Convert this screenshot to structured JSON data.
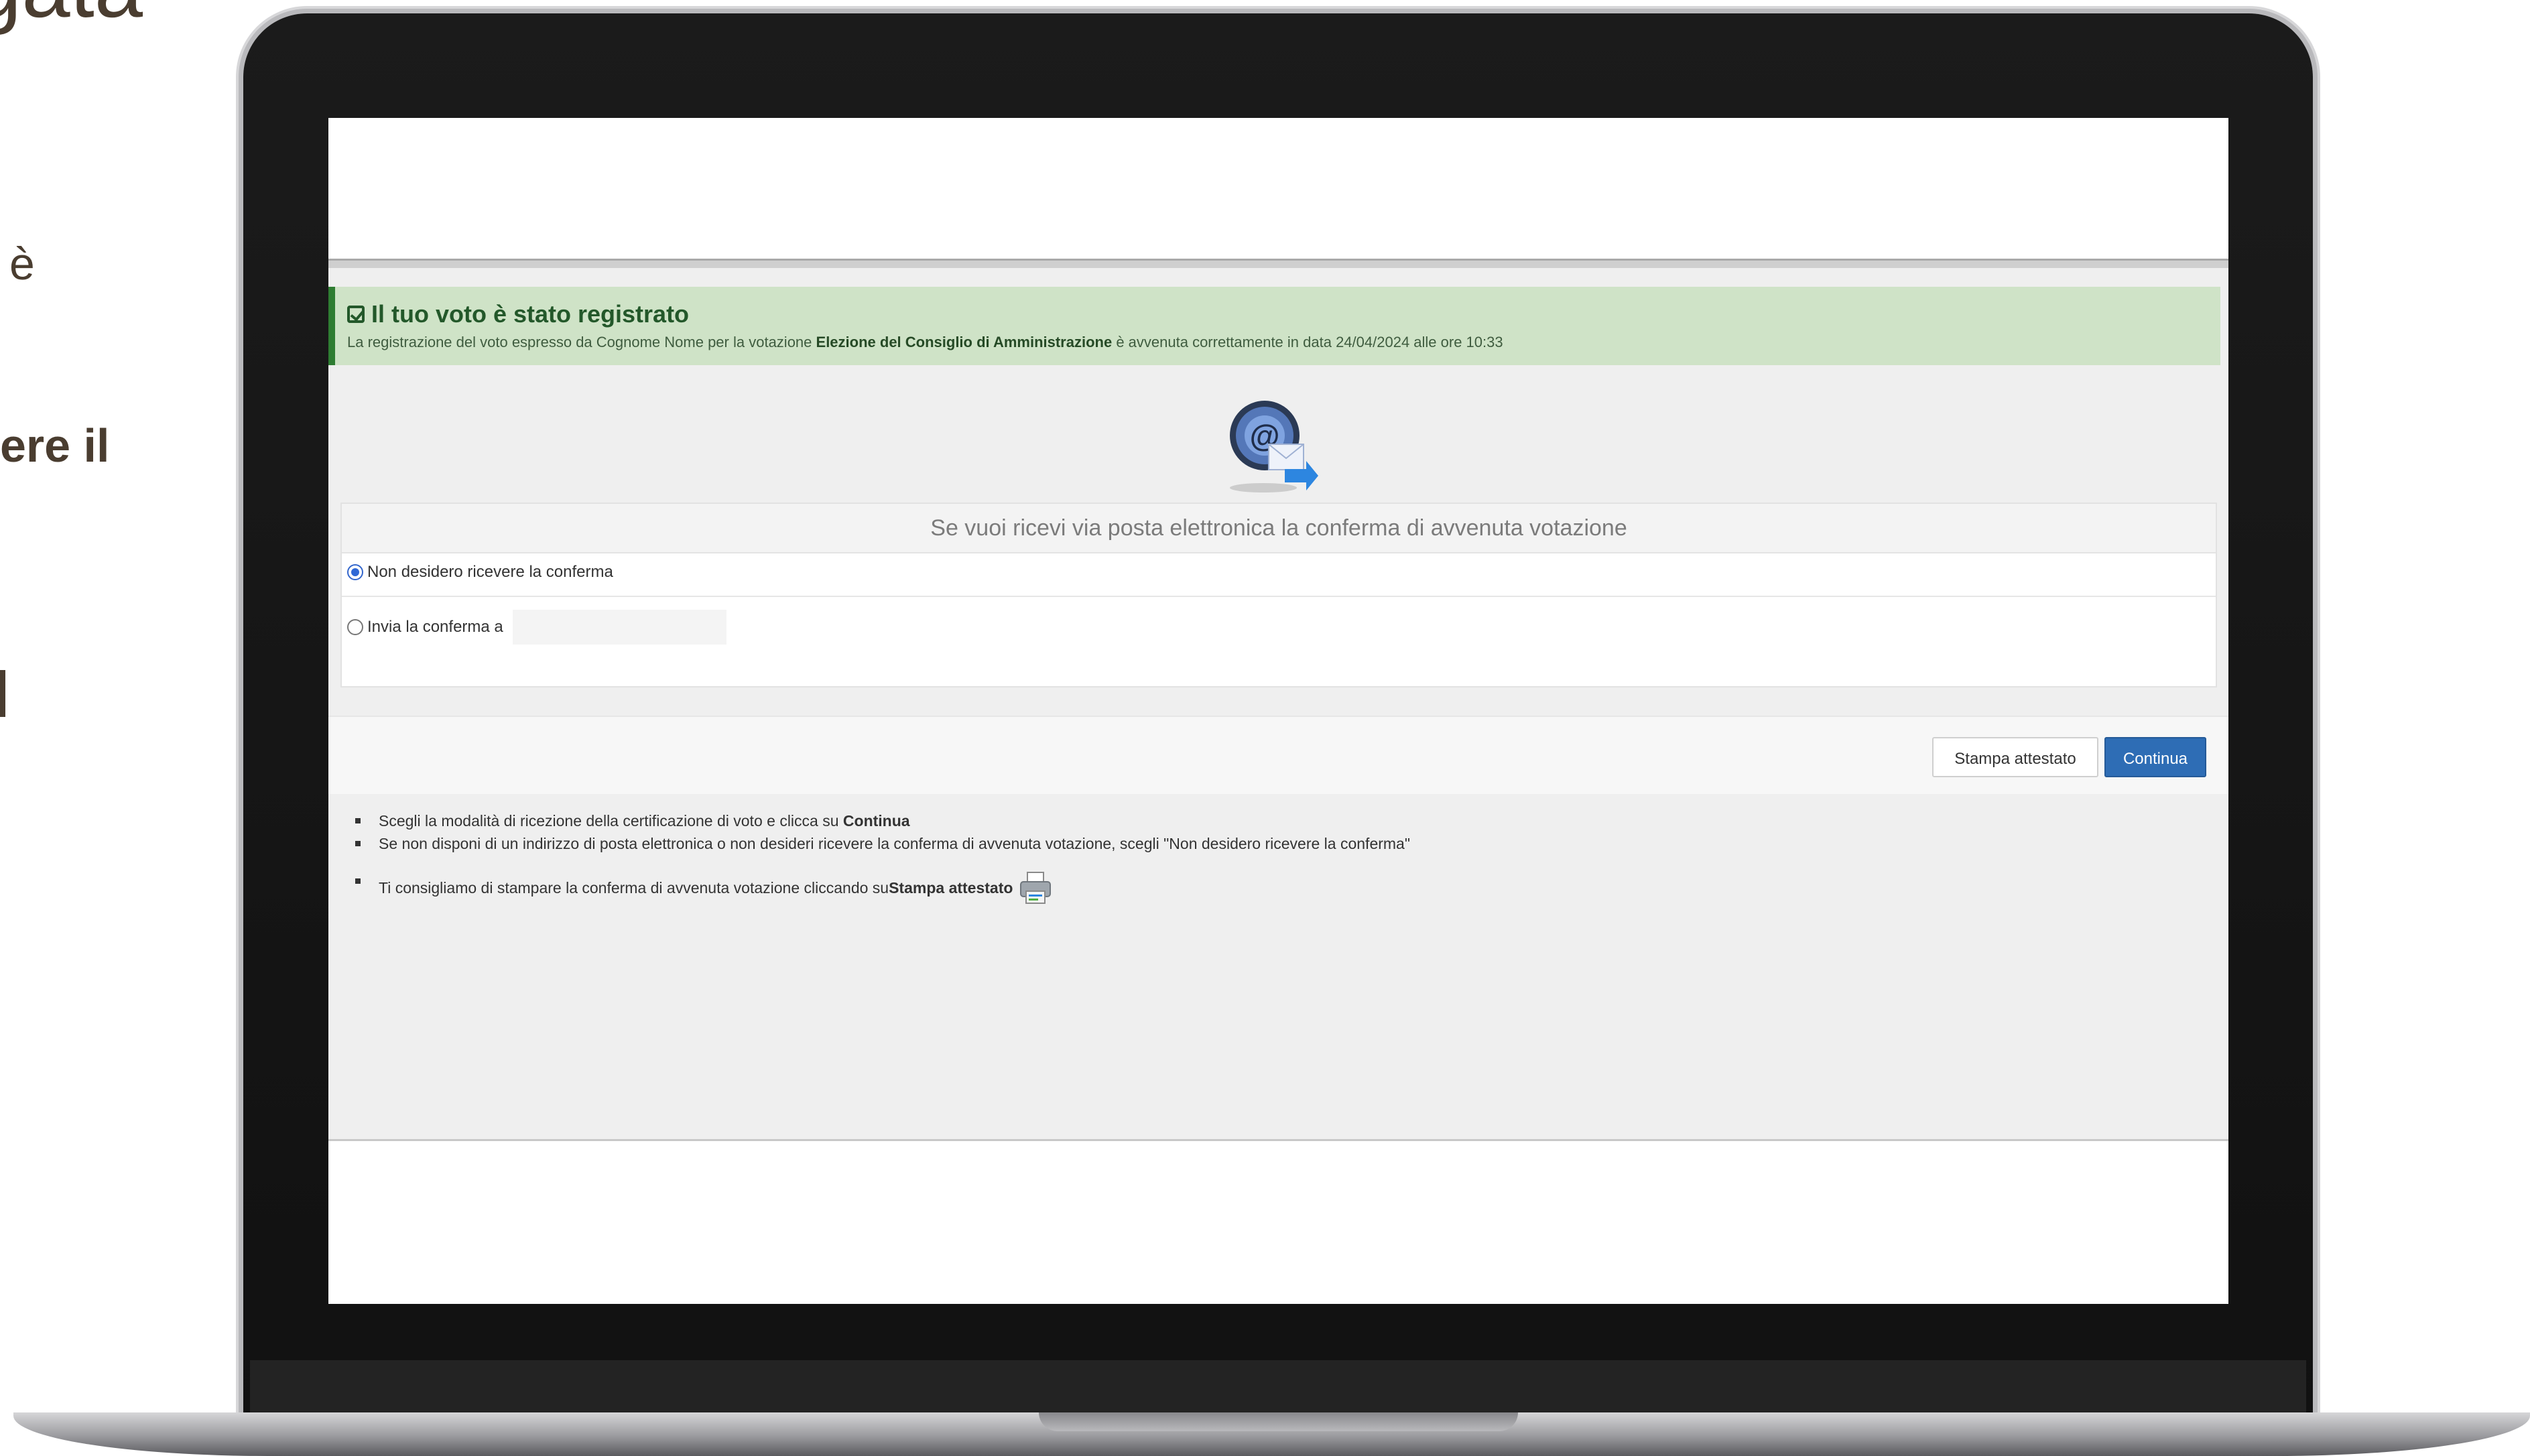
{
  "slide": {
    "title_fragment": "gata",
    "line1_fragment": "è",
    "line2_fragment": "ere il"
  },
  "alert": {
    "title": "Il tuo voto è stato registrato",
    "text_prefix": "La registrazione del voto espresso da Cognome Nome per la votazione ",
    "election": "Elezione del Consiglio di Amministrazione",
    "text_suffix": " è avvenuta correttamente in data 24/04/2024 alle ore 10:33"
  },
  "email_panel": {
    "heading": "Se vuoi ricevi via posta elettronica la conferma di avvenuta votazione",
    "option_no": "Non desidero ricevere la conferma",
    "option_send": "Invia la conferma a",
    "email_value": ""
  },
  "buttons": {
    "print": "Stampa attestato",
    "continue": "Continua"
  },
  "hints": {
    "h1_prefix": "Scegli la modalità di ricezione della certificazione di voto e clicca su ",
    "h1_bold": "Continua",
    "h2": "Se non disponi di un indirizzo di posta elettronica o non desideri ricevere la conferma di avvenuta votazione, scegli \"Non desidero ricevere la conferma\"",
    "h3_prefix": "Ti consigliamo di stampare la conferma di avvenuta votazione cliccando su ",
    "h3_bold": "Stampa attestato"
  },
  "colors": {
    "success_bg": "#cfe3c7",
    "success_text": "#23582a",
    "primary_button": "#2e6db5"
  }
}
